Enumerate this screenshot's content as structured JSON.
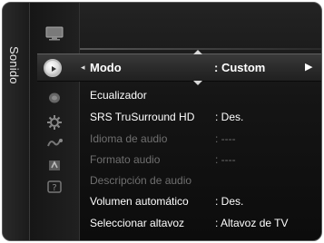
{
  "side_label": "Sonido",
  "selected": {
    "label": "Modo",
    "value": ": Custom"
  },
  "menu": [
    {
      "label": "Ecualizador",
      "value": "",
      "enabled": true
    },
    {
      "label": "SRS TruSurround HD",
      "value": ": Des.",
      "enabled": true
    },
    {
      "label": "Idioma de audio",
      "value": ": ----",
      "enabled": false
    },
    {
      "label": "Formato audio",
      "value": ": ----",
      "enabled": false
    },
    {
      "label": "Descripción de audio",
      "value": "",
      "enabled": false
    },
    {
      "label": "Volumen automático",
      "value": ": Des.",
      "enabled": true
    },
    {
      "label": "Seleccionar altavoz",
      "value": ": Altavoz de TV",
      "enabled": true
    }
  ],
  "icons": {
    "top": "tv-picture-icon",
    "selected": "sound-icon",
    "list": [
      "channel-icon",
      "setup-icon",
      "input-icon",
      "application-icon",
      "support-icon"
    ]
  }
}
